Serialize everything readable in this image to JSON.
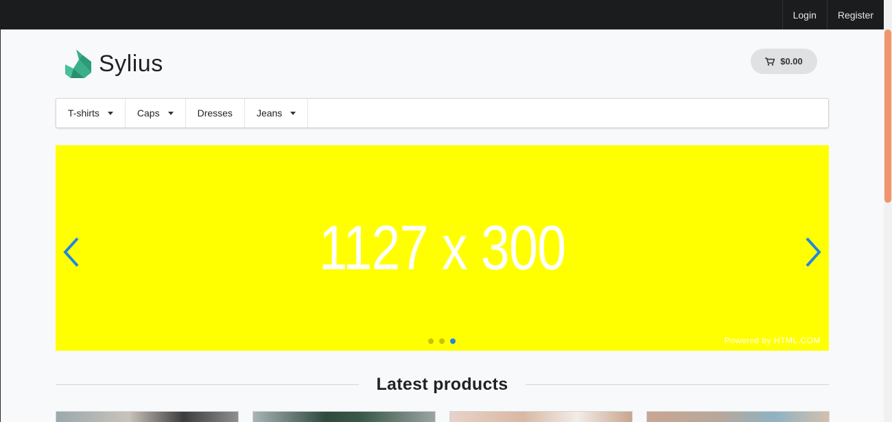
{
  "topbar": {
    "login": "Login",
    "register": "Register"
  },
  "header": {
    "brand": "Sylius",
    "cart_total": "$0.00"
  },
  "menu": {
    "items": [
      {
        "label": "T-shirts",
        "has_dropdown": true
      },
      {
        "label": "Caps",
        "has_dropdown": true
      },
      {
        "label": "Dresses",
        "has_dropdown": false
      },
      {
        "label": "Jeans",
        "has_dropdown": true
      }
    ]
  },
  "banner": {
    "text": "1127 x 300",
    "powered_by": "Powered by HTML.COM",
    "slide_count": 3,
    "active_slide": 3,
    "background": "#ffff00",
    "arrow_color": "#1e88e5"
  },
  "latest": {
    "title": "Latest products"
  },
  "colors": {
    "topbar": "#1b1c1d",
    "brand_logo": "#3aaf8a",
    "scroll_thumb": "#f0956b"
  }
}
